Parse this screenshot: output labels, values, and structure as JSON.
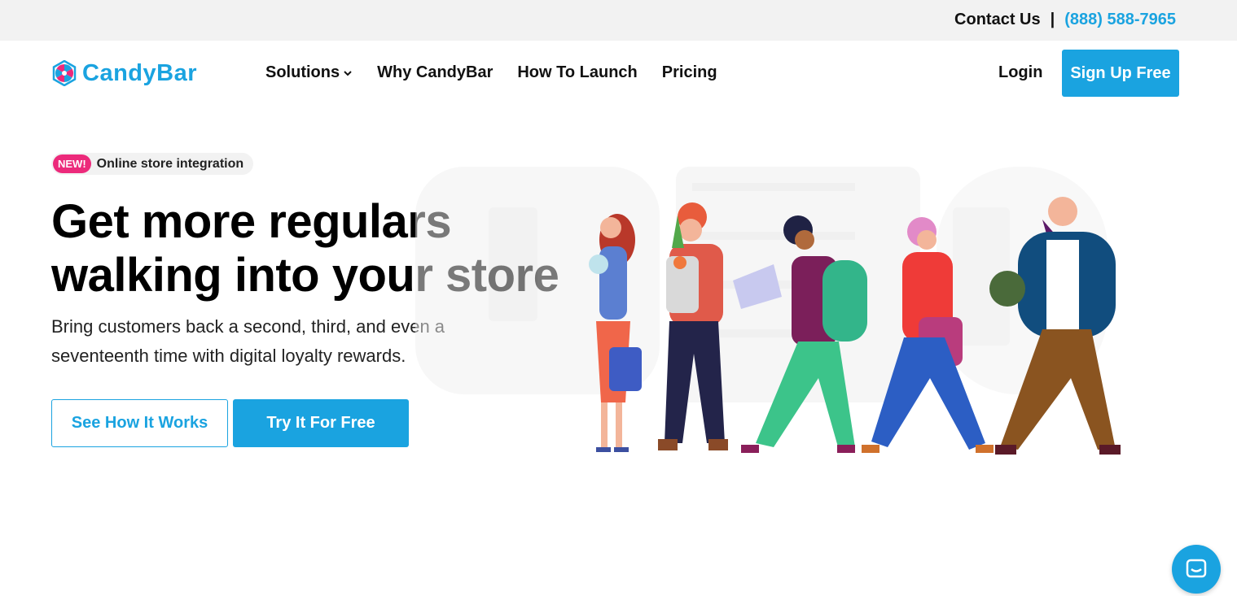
{
  "topbar": {
    "contact_label": "Contact Us",
    "separator": "|",
    "phone": "(888) 588-7965"
  },
  "brand": {
    "name": "CandyBar",
    "logo_icon": "candy-swirl-icon",
    "accent_color": "#1aa3e0"
  },
  "nav": {
    "items": [
      {
        "label": "Solutions",
        "has_dropdown": true
      },
      {
        "label": "Why CandyBar",
        "has_dropdown": false
      },
      {
        "label": "How To Launch",
        "has_dropdown": false
      },
      {
        "label": "Pricing",
        "has_dropdown": false
      }
    ],
    "login_label": "Login",
    "signup_label": "Sign Up Free"
  },
  "hero": {
    "badge_new": "NEW!",
    "badge_text": "Online store integration",
    "headline_line1": "Get more regulars",
    "headline_line2": "walking into your store",
    "subtext_line1": "Bring customers back a second, third, and even a",
    "subtext_line2": "seventeenth time with digital loyalty rewards.",
    "cta_secondary": "See How It Works",
    "cta_primary": "Try It For Free",
    "badge_color": "#ec2a7b"
  },
  "chat": {
    "icon": "chat-bubble-icon"
  }
}
